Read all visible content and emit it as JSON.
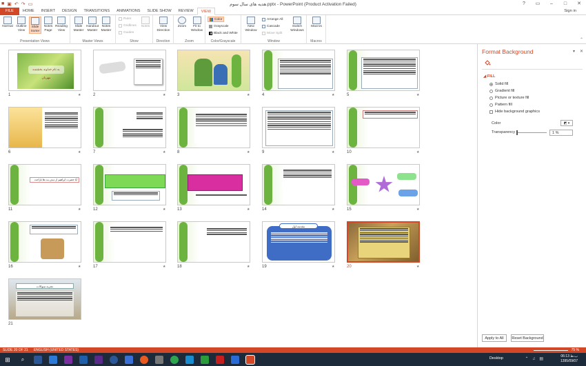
{
  "window": {
    "title": "هدیه های سال سوم.pptx - PowerPoint (Product Activation Failed)",
    "sign_in": "Sign in"
  },
  "tabs": [
    "FILE",
    "HOME",
    "INSERT",
    "DESIGN",
    "TRANSITIONS",
    "ANIMATIONS",
    "SLIDE SHOW",
    "REVIEW",
    "VIEW"
  ],
  "active_tab": "VIEW",
  "ribbon": {
    "presentation_views": {
      "label": "Presentation Views",
      "buttons": [
        "Normal",
        "Outline View",
        "Slide Sorter",
        "Notes Page",
        "Reading View"
      ]
    },
    "master_views": {
      "label": "Master Views",
      "buttons": [
        "Slide Master",
        "Handout Master",
        "Notes Master"
      ]
    },
    "show": {
      "label": "Show",
      "items": [
        "Ruler",
        "Gridlines",
        "Guides"
      ],
      "notes": "Notes"
    },
    "direction": {
      "label": "Direction",
      "button": "View Direction"
    },
    "zoom": {
      "label": "Zoom",
      "buttons": [
        "Zoom",
        "Fit to Window"
      ]
    },
    "color": {
      "label": "Color/Grayscale",
      "items": [
        "Color",
        "Grayscale",
        "Black and White"
      ]
    },
    "window": {
      "label": "Window",
      "new_window": "New Window",
      "items": [
        "Arrange All",
        "Cascade",
        "Move Split"
      ],
      "switch": "Switch Windows"
    },
    "macros": {
      "label": "Macros",
      "button": "Macros"
    }
  },
  "slides": [
    {
      "num": "1"
    },
    {
      "num": "2"
    },
    {
      "num": "3"
    },
    {
      "num": "4"
    },
    {
      "num": "5"
    },
    {
      "num": "6"
    },
    {
      "num": "7"
    },
    {
      "num": "8"
    },
    {
      "num": "9"
    },
    {
      "num": "10"
    },
    {
      "num": "11"
    },
    {
      "num": "12"
    },
    {
      "num": "13"
    },
    {
      "num": "14"
    },
    {
      "num": "15"
    },
    {
      "num": "16"
    },
    {
      "num": "17"
    },
    {
      "num": "18"
    },
    {
      "num": "19"
    },
    {
      "num": "20"
    },
    {
      "num": "21"
    }
  ],
  "selected_slide": "20",
  "slide_text": {
    "s1_title": "به نام خداوند بخشنده مهربان",
    "s19_title": "مقدمه اول",
    "s21_title": "تجربه سوالات",
    "s11_line": "آیا حضرت ابراهیم از دیدن بت ها ناراحت بود؟"
  },
  "pane": {
    "title": "Format Background",
    "fill_header": "FILL",
    "options": [
      "Solid fill",
      "Gradient fill",
      "Picture or texture fill",
      "Pattern fill"
    ],
    "selected_option": "Solid fill",
    "hide_graphics": "Hide background graphics",
    "color_label": "Color",
    "transparency_label": "Transparency",
    "transparency_value": "1 %",
    "apply_all": "Apply to All",
    "reset": "Reset Background"
  },
  "status": {
    "slide": "SLIDE 20 OF 21",
    "language": "ENGLISH (UNITED STATES)",
    "zoom": "75 %"
  },
  "taskbar": {
    "desktop": "Desktop",
    "time": "06:13 ب.ظ",
    "date": "1395/09/07"
  }
}
